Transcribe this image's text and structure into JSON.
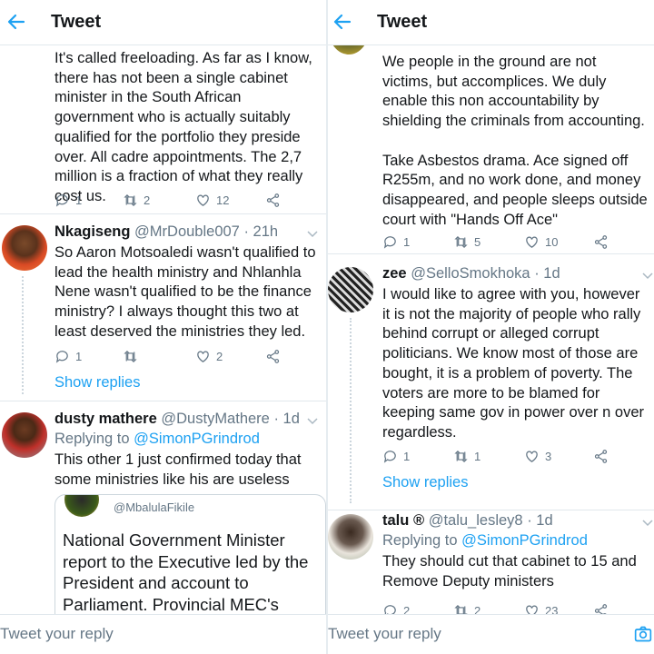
{
  "left_pane": {
    "header": {
      "title": "Tweet",
      "back_icon": "arrow-left-icon"
    },
    "tweets": [
      {
        "text": "It's called freeloading.  As far as I know, there has not been a single cabinet minister in the South African government who is actually suitably qualified for the portfolio they preside over. All cadre appointments. The 2,7 million is a fraction of what they really cost us.",
        "replies": "1",
        "retweets": "2",
        "likes": "12"
      },
      {
        "name": "Nkagiseng",
        "handle": "@MrDouble007",
        "time": "· 21h",
        "text": "So Aaron Motsoaledi wasn't qualified to lead the health ministry and Nhlanhla Nene wasn't qualified to be the finance ministry? I always thought this two at least deserved the ministries they led.",
        "replies": "1",
        "retweets": "",
        "likes": "2",
        "show_replies": "Show replies"
      },
      {
        "name": "dusty mathere",
        "handle": "@DustyMathere",
        "time": "· 1d",
        "replying_prefix": "Replying to",
        "replying_handle": "@SimonPGrindrod",
        "text": "This other 1 just confirmed today that some ministries like his are useless",
        "quote": {
          "handle": "@MbalulaFikile",
          "text": "National Government Minister report to the Executive led by the President and account to Parliament. Provincial MEC's"
        }
      }
    ],
    "reply_placeholder": "Tweet your reply"
  },
  "right_pane": {
    "header": {
      "title": "Tweet",
      "back_icon": "arrow-left-icon"
    },
    "tweets": [
      {
        "text_p1": "We people in the ground are not victims, but accomplices. We duly enable this non accountability by shielding the criminals from accounting.",
        "text_p2": "Take Asbestos drama. Ace signed off R255m, and no work done, and money disappeared, and people sleeps outside court with \"Hands Off Ace\"",
        "replies": "1",
        "retweets": "5",
        "likes": "10"
      },
      {
        "name": "zee",
        "handle": "@SelloSmokhoka",
        "time": "· 1d",
        "text": "I would like to agree with you, however it is not the majority of people who rally behind corrupt or alleged corrupt politicians. We know most of those are bought, it is a problem of poverty. The voters are more to be blamed for keeping same gov in power over n over regardless.",
        "replies": "1",
        "retweets": "1",
        "likes": "3",
        "show_replies": "Show replies"
      },
      {
        "name": "talu",
        "name_badge": "®",
        "handle": "@talu_lesley8",
        "time": "· 1d",
        "replying_prefix": "Replying to",
        "replying_handle": "@SimonPGrindrod",
        "text": "They should cut that cabinet to 15 and Remove Deputy ministers",
        "replies": "2",
        "retweets": "2",
        "likes": "23"
      }
    ],
    "reply_placeholder": "Tweet your reply"
  },
  "colors": {
    "accent": "#1da1f2",
    "secondary_text": "#657786",
    "divider": "#e1e8ed"
  }
}
